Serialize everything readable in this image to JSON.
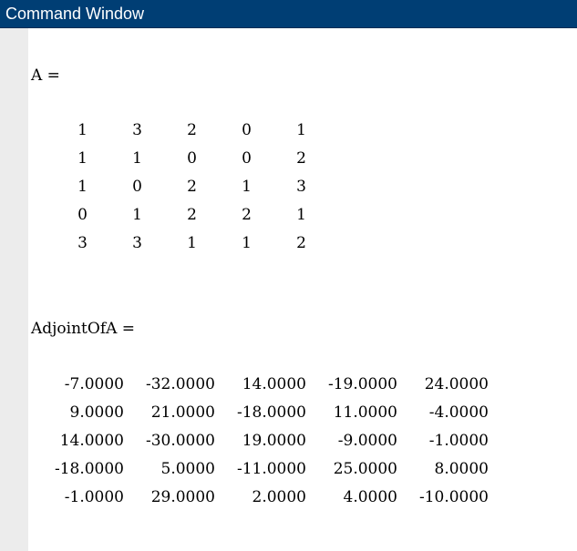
{
  "window": {
    "title": "Command Window"
  },
  "console": {
    "matrix_a": {
      "label": "A =",
      "rows": [
        [
          "1",
          "3",
          "2",
          "0",
          "1"
        ],
        [
          "1",
          "1",
          "0",
          "0",
          "2"
        ],
        [
          "1",
          "0",
          "2",
          "1",
          "3"
        ],
        [
          "0",
          "1",
          "2",
          "2",
          "1"
        ],
        [
          "3",
          "3",
          "1",
          "1",
          "2"
        ]
      ]
    },
    "adjoint": {
      "label": "AdjointOfA =",
      "rows": [
        [
          "-7.0000",
          "-32.0000",
          "14.0000",
          "-19.0000",
          "24.0000"
        ],
        [
          "9.0000",
          "21.0000",
          "-18.0000",
          "11.0000",
          "-4.0000"
        ],
        [
          "14.0000",
          "-30.0000",
          "19.0000",
          "-9.0000",
          "-1.0000"
        ],
        [
          "-18.0000",
          "5.0000",
          "-11.0000",
          "25.0000",
          "8.0000"
        ],
        [
          "-1.0000",
          "29.0000",
          "2.0000",
          "4.0000",
          "-10.0000"
        ]
      ]
    }
  }
}
